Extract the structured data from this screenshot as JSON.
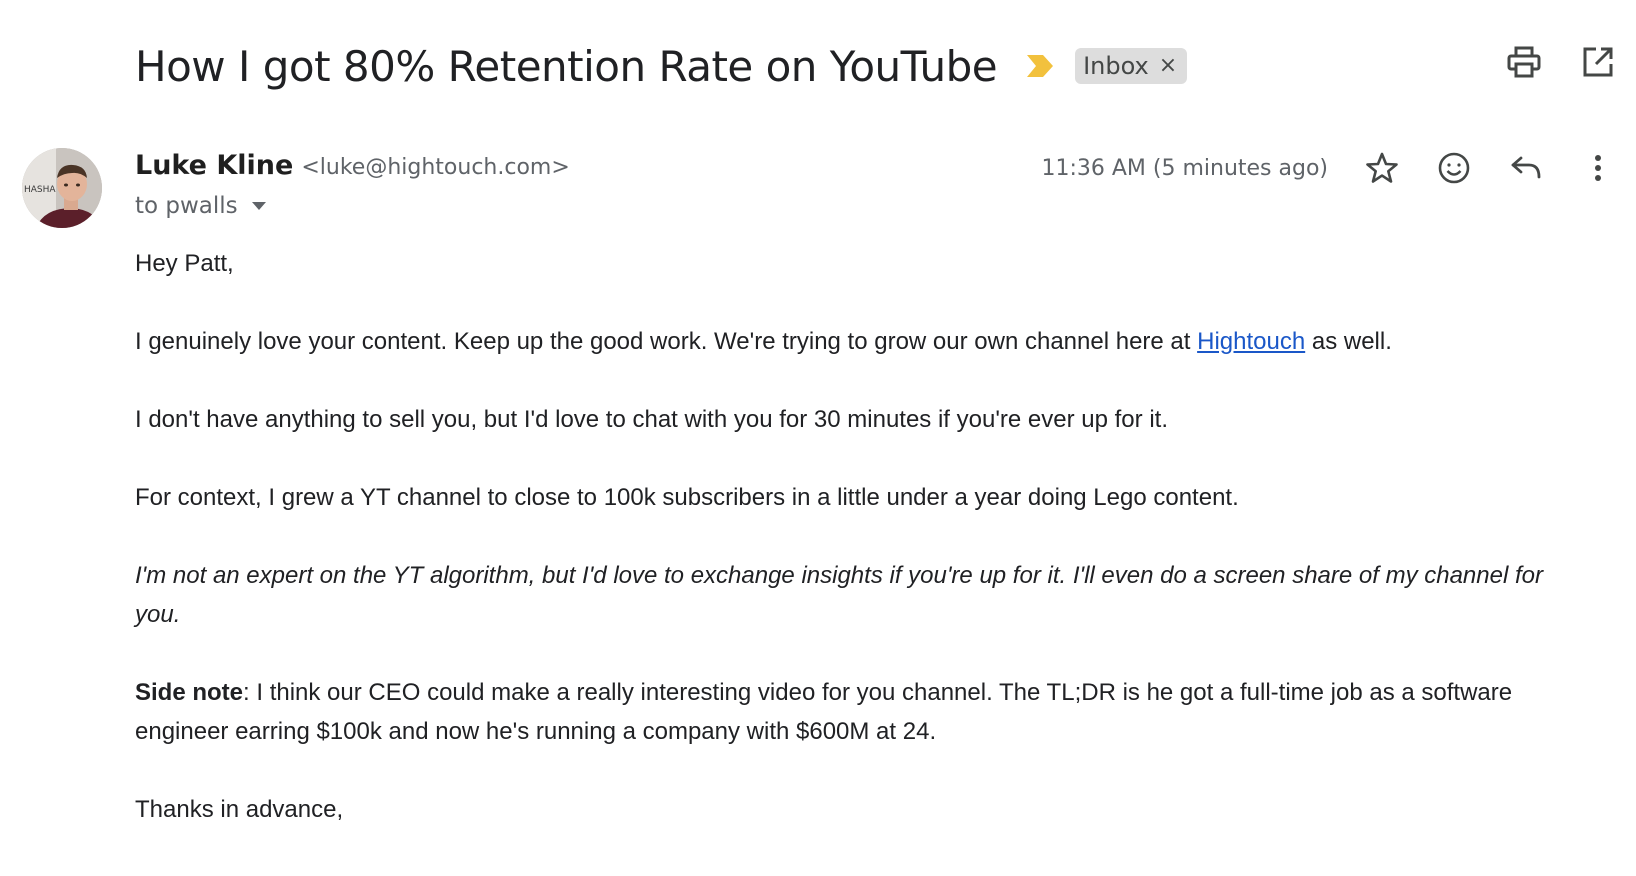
{
  "subject": {
    "title": "How I got 80% Retention Rate on YouTube",
    "importance_icon": "importance-marker-icon",
    "label": "Inbox",
    "label_close": "×",
    "importance_color": "#f2c13d"
  },
  "top_actions": [
    {
      "name": "print-all-icon"
    },
    {
      "name": "open-in-new-window-icon"
    }
  ],
  "sender": {
    "name": "Luke Kline",
    "email": "<luke@hightouch.com>",
    "to": "to pwalls",
    "avatar_text": "HASHA"
  },
  "meta": {
    "timestamp": "11:36 AM (5 minutes ago)",
    "icons": [
      "star-icon",
      "emoji-reaction-icon",
      "reply-icon",
      "more-options-icon"
    ]
  },
  "body": {
    "greeting": "Hey Patt,",
    "p1_before": "I genuinely love your content. Keep up the good work. We're trying to grow our own channel here at ",
    "p1_link": "Hightouch",
    "p1_after": " as well.",
    "p2": "I don't have anything to sell you, but I'd love to chat with you for 30 minutes if you're ever up for it.",
    "p3": "For context, I grew a YT channel to close to 100k subscribers in a little under a year doing Lego content.",
    "p4": "I'm not an expert on the YT algorithm, but I'd love to exchange insights if you're up for it. I'll even do a screen share of my channel for you.",
    "p5_bold": "Side note",
    "p5_rest": ": I think our CEO could make a really interesting video for you channel. The TL;DR is he got a full-time job as a software engineer earring $100k and now he's running a company with $600M at 24.",
    "closing": "Thanks in advance,"
  },
  "colors": {
    "link": "#1a57c8",
    "chip_bg": "#dddddd",
    "secondary_text": "#5f6368"
  }
}
